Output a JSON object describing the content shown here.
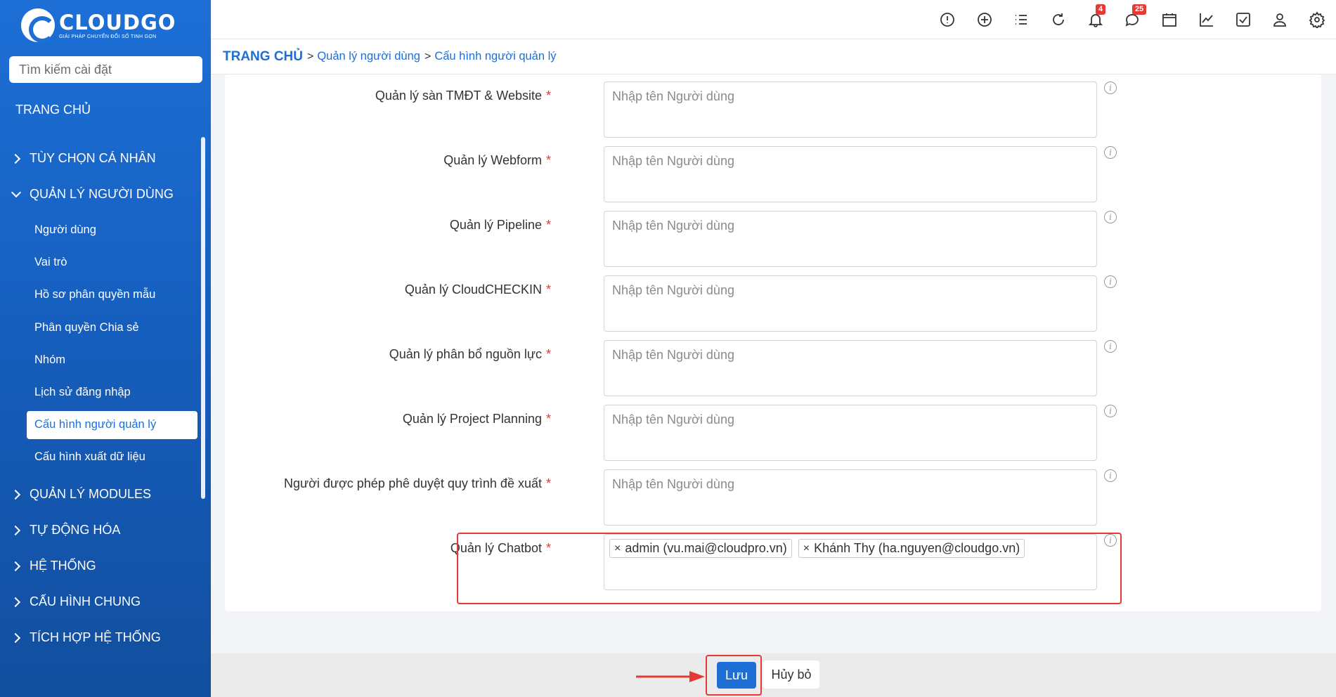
{
  "colors": {
    "accent": "#1d6fd6",
    "required": "#e53935",
    "highlight": "#e53935"
  },
  "logo": {
    "name": "CLOUDGO",
    "tagline": "GIẢI PHÁP CHUYỂN ĐỔI SỐ TINH GỌN"
  },
  "sidebar": {
    "search_placeholder": "Tìm kiếm cài đặt",
    "home": "TRANG CHỦ",
    "menu": [
      {
        "label": "TÙY CHỌN CÁ NHÂN",
        "expanded": false
      },
      {
        "label": "QUẢN LÝ NGƯỜI DÙNG",
        "expanded": true,
        "items": [
          "Người dùng",
          "Vai trò",
          "Hồ sơ phân quyền mẫu",
          "Phân quyền Chia sẻ",
          "Nhóm",
          "Lịch sử đăng nhập",
          "Cấu hình người quản lý",
          "Cấu hình xuất dữ liệu"
        ],
        "active": "Cấu hình người quản lý"
      },
      {
        "label": "QUẢN LÝ MODULES",
        "expanded": false
      },
      {
        "label": "TỰ ĐỘNG HÓA",
        "expanded": false
      },
      {
        "label": "HỆ THỐNG",
        "expanded": false
      },
      {
        "label": "CẤU HÌNH CHUNG",
        "expanded": false
      },
      {
        "label": "TÍCH HỢP HỆ THỐNG",
        "expanded": false
      }
    ]
  },
  "topbar": {
    "icons": [
      "alert-icon",
      "plus-circle-icon",
      "list-icon",
      "refresh-icon",
      "bell-icon",
      "chat-icon",
      "calendar-icon",
      "chart-icon",
      "checkbox-icon",
      "user-icon",
      "gear-icon"
    ],
    "notifications_count": "4",
    "messages_count": "25"
  },
  "breadcrumb": {
    "home": "TRANG CHỦ",
    "sep": ">",
    "items": [
      "Quản lý người dùng",
      "Cấu hình người quản lý"
    ]
  },
  "form": {
    "required_mark": "*",
    "placeholder": "Nhập tên Người dùng",
    "info_glyph": "i",
    "rows": [
      {
        "label": "Quản lý sàn TMĐT & Website"
      },
      {
        "label": "Quản lý Webform"
      },
      {
        "label": "Quản lý Pipeline"
      },
      {
        "label": "Quản lý CloudCHECKIN"
      },
      {
        "label": "Quản lý phân bổ nguồn lực"
      },
      {
        "label": "Quản lý Project Planning"
      },
      {
        "label": "Người được phép phê duyệt quy trình đề xuất"
      },
      {
        "label": "Quản lý Chatbot",
        "tags": [
          "admin (vu.mai@cloudpro.vn)",
          "Khánh Thy (ha.nguyen@cloudgo.vn)"
        ]
      }
    ]
  },
  "footer": {
    "save_label": "Lưu",
    "cancel_label": "Hủy bỏ"
  }
}
